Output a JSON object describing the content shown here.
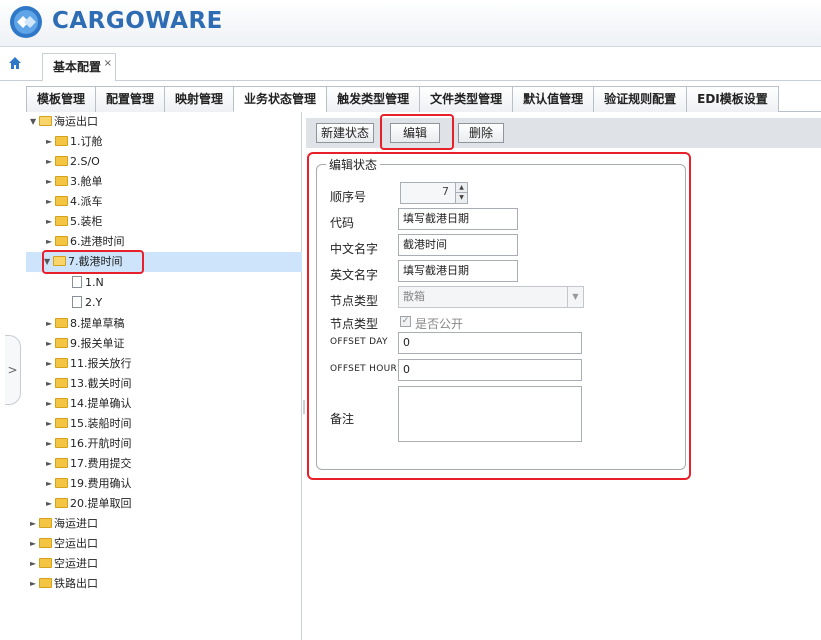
{
  "app": {
    "title": "CARGOWARE"
  },
  "page_tab": {
    "label": "基本配置",
    "close": "×"
  },
  "module_tabs": [
    {
      "label": "模板管理"
    },
    {
      "label": "配置管理"
    },
    {
      "label": "映射管理"
    },
    {
      "label": "业务状态管理"
    },
    {
      "label": "触发类型管理"
    },
    {
      "label": "文件类型管理"
    },
    {
      "label": "默认值管理"
    },
    {
      "label": "验证规则配置"
    },
    {
      "label": "EDI模板设置"
    }
  ],
  "active_tab": "业务状态管理",
  "tree": {
    "root": "海运出口",
    "children": [
      "1.订舱",
      "2.S/O",
      "3.舱单",
      "4.派车",
      "5.装柜",
      "6.进港时间",
      "7.截港时间"
    ],
    "selected": "7.截港时间",
    "selected_children": [
      "1.N",
      "2.Y"
    ],
    "children_after": [
      "8.提单草稿",
      "9.报关单证",
      "11.报关放行",
      "13.截关时间",
      "14.提单确认",
      "15.装船时间",
      "16.开航时间",
      "17.费用提交",
      "19.费用确认",
      "20.提单取回"
    ],
    "other_roots": [
      "海运进口",
      "空运出口",
      "空运进口",
      "铁路出口"
    ]
  },
  "toolbar": {
    "new_label": "新建状态",
    "edit_label": "编辑",
    "delete_label": "删除"
  },
  "form": {
    "legend": "编辑状态",
    "seq_label": "顺序号",
    "seq_value": "7",
    "code_label": "代码",
    "code_value": "填写截港日期",
    "cn_name_label": "中文名字",
    "cn_name_value": "截港时间",
    "en_name_label": "英文名字",
    "en_name_value": "填写截港日期",
    "node_type_label": "节点类型",
    "node_type_value": "散箱",
    "node_type2_label": "节点类型",
    "public_label": "是否公开",
    "public_checked": true,
    "offset_day_label": "OFFSET DAY",
    "offset_day_value": "0",
    "offset_hour_label": "OFFSET HOUR",
    "offset_hour_value": "0",
    "remark_label": "备注",
    "remark_value": ""
  },
  "colors": {
    "highlight": "#e8202a",
    "selected_row": "#cde4fb",
    "brand": "#2e6db4"
  }
}
